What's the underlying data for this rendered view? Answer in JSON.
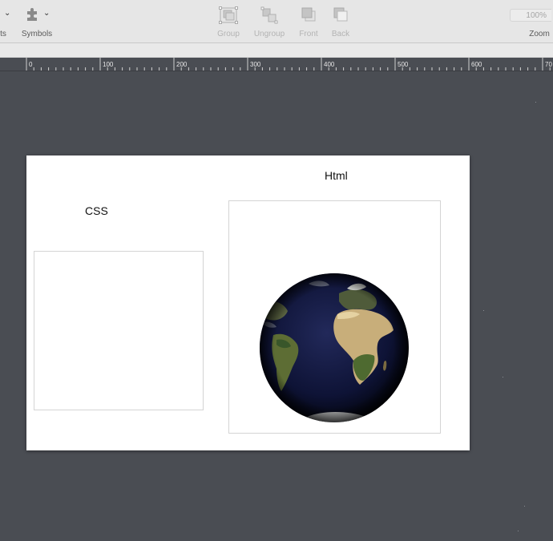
{
  "toolbar": {
    "partial_label": "ts",
    "symbols_label": "Symbols",
    "group_label": "Group",
    "ungroup_label": "Ungroup",
    "front_label": "Front",
    "back_label": "Back",
    "zoom_value": "100%",
    "zoom_label": "Zoom"
  },
  "ruler": {
    "ticks": [
      "0",
      "100",
      "200",
      "300",
      "400",
      "500",
      "600",
      "70"
    ]
  },
  "canvas": {
    "css_label": "CSS",
    "html_label": "Html"
  }
}
